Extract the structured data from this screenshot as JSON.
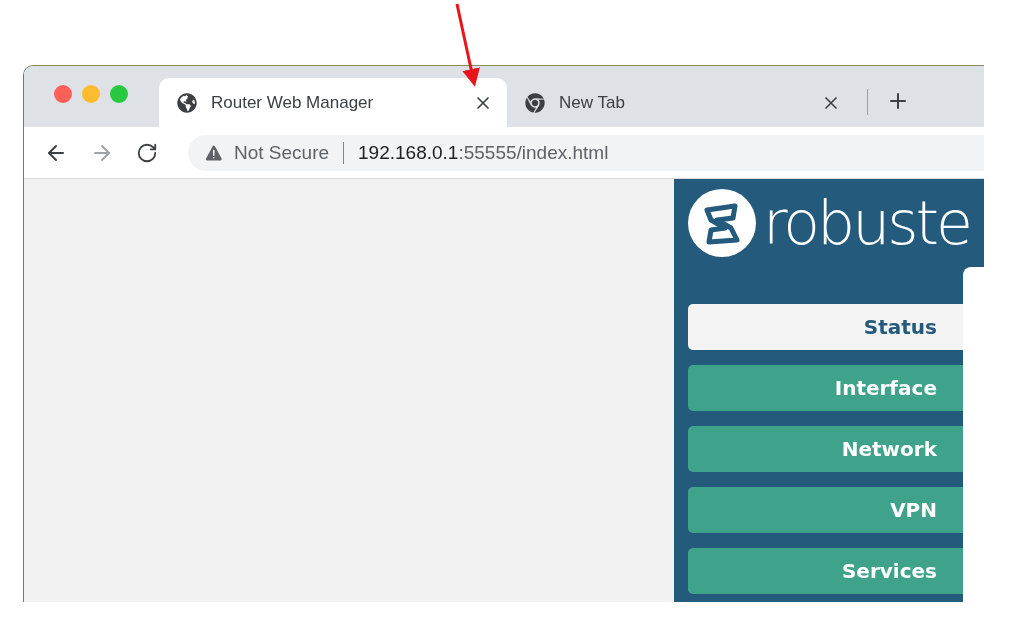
{
  "tabs": [
    {
      "title": "Router Web Manager",
      "kind": "globe",
      "selected": true
    },
    {
      "title": "New Tab",
      "kind": "chrome",
      "selected": false
    }
  ],
  "address_bar": {
    "security": "Not Secure",
    "host": "192.168.0.1",
    "path": ":55555/index.html"
  },
  "logo": {
    "wordmark": "robuste"
  },
  "menu": [
    {
      "label": "Status",
      "selected": true
    },
    {
      "label": "Interface",
      "selected": false
    },
    {
      "label": "Network",
      "selected": false
    },
    {
      "label": "VPN",
      "selected": false
    },
    {
      "label": "Services",
      "selected": false
    }
  ]
}
